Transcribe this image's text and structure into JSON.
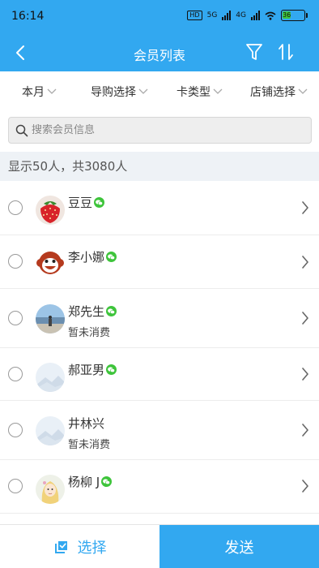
{
  "status_bar": {
    "time": "16:14",
    "hd": "HD",
    "net1": "5G",
    "net2": "4G",
    "battery": "36"
  },
  "nav": {
    "title": "会员列表"
  },
  "filters": [
    {
      "label": "本月"
    },
    {
      "label": "导购选择"
    },
    {
      "label": "卡类型"
    },
    {
      "label": "店铺选择"
    }
  ],
  "search": {
    "placeholder": "搜索会员信息",
    "value": ""
  },
  "summary": "显示50人，共3080人",
  "members": [
    {
      "name": "豆豆",
      "wechat": true,
      "note": "",
      "avatar": "strawberry"
    },
    {
      "name": "李小娜",
      "wechat": true,
      "note": "",
      "avatar": "monkey"
    },
    {
      "name": "郑先生",
      "wechat": true,
      "note": "暂未消费",
      "avatar": "landscape-photo"
    },
    {
      "name": "郝亚男",
      "wechat": true,
      "note": "",
      "avatar": "placeholder"
    },
    {
      "name": "井林兴",
      "wechat": false,
      "note": "暂未消费",
      "avatar": "placeholder"
    },
    {
      "name": "杨柳 J",
      "wechat": true,
      "note": "",
      "avatar": "cartoon-girl"
    }
  ],
  "bottom": {
    "select_label": "选择",
    "send_label": "发送"
  },
  "colors": {
    "primary": "#32a8f0",
    "wechat": "#3ec43b"
  }
}
